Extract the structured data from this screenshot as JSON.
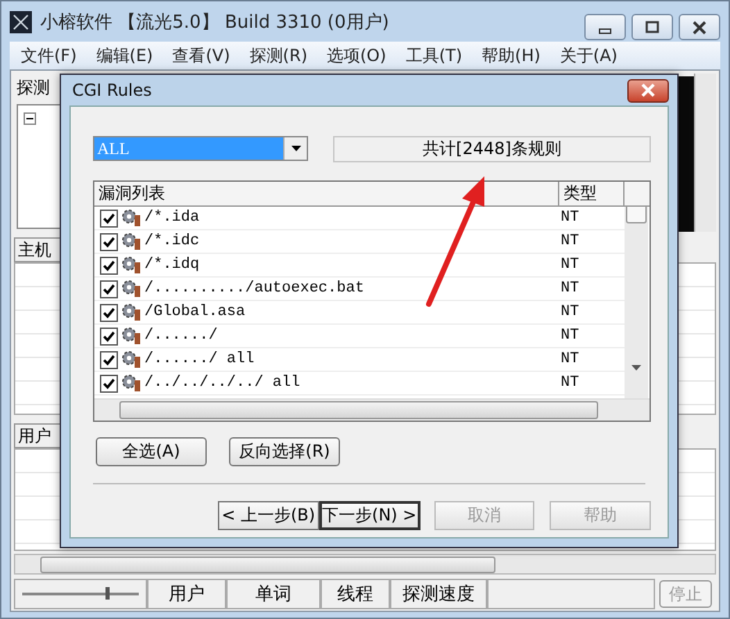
{
  "window": {
    "title": "小榕软件 【流光5.0】 Build 3310 (0用户)"
  },
  "menu": [
    {
      "label": "文件(F)"
    },
    {
      "label": "编辑(E)"
    },
    {
      "label": "查看(V)"
    },
    {
      "label": "探测(R)"
    },
    {
      "label": "选项(O)"
    },
    {
      "label": "工具(T)"
    },
    {
      "label": "帮助(H)"
    },
    {
      "label": "关于(A)"
    }
  ],
  "main": {
    "tab": "探测",
    "host_header": "主机",
    "user_header": "用户"
  },
  "dialog": {
    "title": "CGI Rules",
    "filter": {
      "value": "ALL"
    },
    "count": "共计[2448]条规则",
    "list": {
      "columns": [
        "漏洞列表",
        "类型"
      ],
      "rows": [
        {
          "rule": "/*.ida",
          "type": "NT",
          "checked": true
        },
        {
          "rule": "/*.idc",
          "type": "NT",
          "checked": true
        },
        {
          "rule": "/*.idq",
          "type": "NT",
          "checked": true
        },
        {
          "rule": "/........../autoexec.bat",
          "type": "NT",
          "checked": true
        },
        {
          "rule": "/Global.asa",
          "type": "NT",
          "checked": true
        },
        {
          "rule": "/....../",
          "type": "NT",
          "checked": true
        },
        {
          "rule": "/....../ all",
          "type": "NT",
          "checked": true
        },
        {
          "rule": "/../../../../ all",
          "type": "NT",
          "checked": true
        }
      ]
    },
    "buttons": [
      {
        "label": "全选(A)"
      },
      {
        "label": "反向选择(R)"
      }
    ],
    "nav": [
      {
        "label": "< 上一步(B)",
        "disabled": false,
        "default": false
      },
      {
        "label": "下一步(N) >",
        "disabled": false,
        "default": true
      },
      {
        "label": "取消",
        "disabled": true,
        "default": false
      },
      {
        "label": "帮助",
        "disabled": true,
        "default": false
      }
    ]
  },
  "status_bar": {
    "slider": {
      "level": 0.72
    },
    "cells": [
      "用户",
      "单词",
      "线程",
      "探测速度"
    ],
    "stop": {
      "label": "停止",
      "disabled": true
    }
  }
}
